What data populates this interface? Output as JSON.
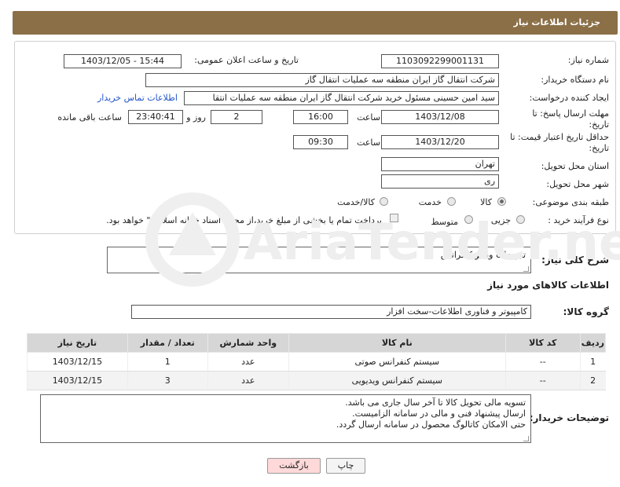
{
  "header": {
    "title": "جزئیات اطلاعات نیاز"
  },
  "fields": {
    "need_number_label": "شماره نیاز:",
    "need_number": "1103092299001131",
    "announce_label": "تاریخ و ساعت اعلان عمومی:",
    "announce_value": "1403/12/05 - 15:44",
    "buyer_org_label": "نام دستگاه خریدار:",
    "buyer_org": "شرکت انتقال گاز ایران منطقه سه عملیات انتقال گاز",
    "requester_label": "ایجاد کننده درخواست:",
    "requester": "سید امین حسینی مسئول خرید شرکت انتقال گاز ایران منطقه سه عملیات انتقا",
    "contact_link": "اطلاعات تماس خریدار",
    "reply_deadline_label": "مهلت ارسال پاسخ: تا تاریخ:",
    "reply_date": "1403/12/08",
    "time_label": "ساعت",
    "reply_time": "16:00",
    "days_value": "2",
    "days_label": "روز و",
    "remaining_time": "23:40:41",
    "remaining_label": "ساعت باقی مانده",
    "validity_label": "حداقل تاریخ اعتبار قیمت: تا تاریخ:",
    "validity_date": "1403/12/20",
    "validity_time": "09:30",
    "province_label": "استان محل تحویل:",
    "province": "تهران",
    "city_label": "شهر محل تحویل:",
    "city": "ری",
    "category_label": "طبقه بندی موضوعی:",
    "category_options": [
      "کالا",
      "خدمت",
      "کالا/خدمت"
    ],
    "process_label": "نوع فرآیند خرید :",
    "process_options": [
      "جزیی",
      "متوسط"
    ],
    "process_note": "پرداخت تمام یا بخشی از مبلغ خرید،از محل \"اسناد خزانه اسلامی\" خواهد بود."
  },
  "summary": {
    "label": "شرح کلی نیاز:",
    "value": "تجهیزات ویدیو کنفرانس"
  },
  "goods_section": {
    "title": "اطلاعات کالاهای مورد نیاز",
    "group_label": "گروه کالا:",
    "group_value": "کامپیوتر و فناوری اطلاعات-سخت افزار"
  },
  "table": {
    "headers": [
      "ردیف",
      "کد کالا",
      "نام کالا",
      "واحد شمارش",
      "تعداد / مقدار",
      "تاریخ نیاز"
    ],
    "rows": [
      [
        "1",
        "--",
        "سیستم کنفرانس صوتی",
        "عدد",
        "1",
        "1403/12/15"
      ],
      [
        "2",
        "--",
        "سیستم کنفرانس ویدیویی",
        "عدد",
        "3",
        "1403/12/15"
      ]
    ]
  },
  "buyer_notes": {
    "label": "توضیحات خریدار:",
    "lines": [
      "تسویه مالی تحویل کالا تا آخر سال جاری می باشد.",
      "ارسال پیشنهاد فنی و مالی در سامانه الزامیست.",
      "حتی الامکان کاتالوگ محصول در سامانه ارسال گردد."
    ]
  },
  "buttons": {
    "print": "چاپ",
    "back": "بازگشت"
  },
  "watermark": {
    "text": "AriaTender.neT"
  }
}
